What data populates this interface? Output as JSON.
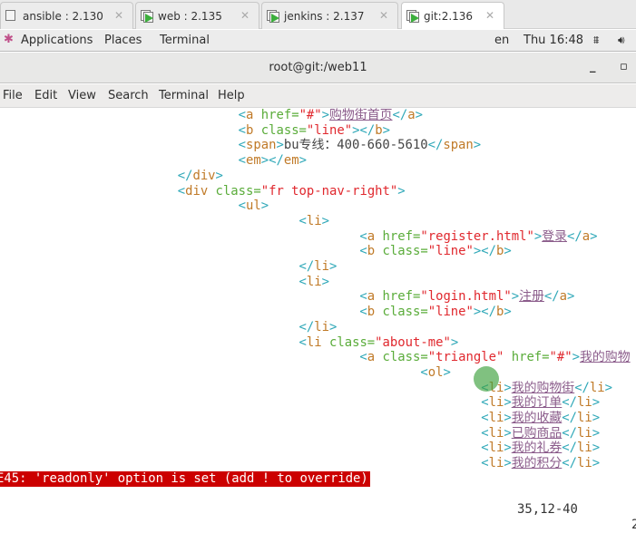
{
  "tabs": [
    {
      "label": "ansible : 2.130",
      "icon": "vm-icon",
      "active": false
    },
    {
      "label": "web : 2.135",
      "icon": "vm-running-icon",
      "active": false
    },
    {
      "label": "jenkins : 2.137",
      "icon": "vm-running-icon",
      "active": false
    },
    {
      "label": "git:2.136",
      "icon": "vm-running-icon",
      "active": true
    }
  ],
  "topbar": {
    "applications": "Applications",
    "places": "Places",
    "terminal": "Terminal",
    "lang": "en",
    "clock": "Thu 16:48"
  },
  "window": {
    "title": "root@git:/web11",
    "minimize": "_",
    "maximize": "▫"
  },
  "menu": [
    "File",
    "Edit",
    "View",
    "Search",
    "Terminal",
    "Help"
  ],
  "editor": {
    "lines": [
      {
        "indent": 32,
        "segs": [
          [
            "p",
            "<"
          ],
          [
            "t",
            "a"
          ],
          [
            "a",
            " href="
          ],
          [
            "s",
            "\"#\""
          ],
          [
            "p",
            ">"
          ],
          [
            "l",
            "购物街首页"
          ],
          [
            "p",
            "</"
          ],
          [
            "t",
            "a"
          ],
          [
            "p",
            ">"
          ]
        ]
      },
      {
        "indent": 32,
        "segs": [
          [
            "p",
            "<"
          ],
          [
            "t",
            "b"
          ],
          [
            "a",
            " class="
          ],
          [
            "s",
            "\"line\""
          ],
          [
            "p",
            ">"
          ],
          [
            "p",
            "</"
          ],
          [
            "t",
            "b"
          ],
          [
            "p",
            ">"
          ]
        ]
      },
      {
        "indent": 32,
        "segs": [
          [
            "p",
            "<"
          ],
          [
            "t",
            "span"
          ],
          [
            "p",
            ">"
          ],
          [
            "x",
            "bu专线：400-660-5610"
          ],
          [
            "p",
            "</"
          ],
          [
            "t",
            "span"
          ],
          [
            "p",
            ">"
          ]
        ]
      },
      {
        "indent": 32,
        "segs": [
          [
            "p",
            "<"
          ],
          [
            "t",
            "em"
          ],
          [
            "p",
            ">"
          ],
          [
            "p",
            "</"
          ],
          [
            "t",
            "em"
          ],
          [
            "p",
            ">"
          ]
        ]
      },
      {
        "indent": 24,
        "segs": [
          [
            "p",
            "</"
          ],
          [
            "t",
            "div"
          ],
          [
            "p",
            ">"
          ]
        ]
      },
      {
        "indent": 24,
        "segs": [
          [
            "p",
            "<"
          ],
          [
            "t",
            "div"
          ],
          [
            "a",
            " class="
          ],
          [
            "s",
            "\"fr top-nav-right\""
          ],
          [
            "p",
            ">"
          ]
        ]
      },
      {
        "indent": 32,
        "segs": [
          [
            "p",
            "<"
          ],
          [
            "t",
            "ul"
          ],
          [
            "p",
            ">"
          ]
        ]
      },
      {
        "indent": 40,
        "segs": [
          [
            "p",
            "<"
          ],
          [
            "t",
            "li"
          ],
          [
            "p",
            ">"
          ]
        ]
      },
      {
        "indent": 48,
        "segs": [
          [
            "p",
            "<"
          ],
          [
            "t",
            "a"
          ],
          [
            "a",
            " href="
          ],
          [
            "s",
            "\"register.html\""
          ],
          [
            "p",
            ">"
          ],
          [
            "l",
            "登录"
          ],
          [
            "p",
            "</"
          ],
          [
            "t",
            "a"
          ],
          [
            "p",
            ">"
          ]
        ]
      },
      {
        "indent": 48,
        "segs": [
          [
            "p",
            "<"
          ],
          [
            "t",
            "b"
          ],
          [
            "a",
            " class="
          ],
          [
            "s",
            "\"line\""
          ],
          [
            "p",
            ">"
          ],
          [
            "p",
            "</"
          ],
          [
            "t",
            "b"
          ],
          [
            "p",
            ">"
          ]
        ]
      },
      {
        "indent": 40,
        "segs": [
          [
            "p",
            "</"
          ],
          [
            "t",
            "li"
          ],
          [
            "p",
            ">"
          ]
        ]
      },
      {
        "indent": 40,
        "segs": [
          [
            "p",
            "<"
          ],
          [
            "t",
            "li"
          ],
          [
            "p",
            ">"
          ]
        ]
      },
      {
        "indent": 48,
        "segs": [
          [
            "p",
            "<"
          ],
          [
            "t",
            "a"
          ],
          [
            "a",
            " href="
          ],
          [
            "s",
            "\"login.html\""
          ],
          [
            "p",
            ">"
          ],
          [
            "l",
            "注册"
          ],
          [
            "p",
            "</"
          ],
          [
            "t",
            "a"
          ],
          [
            "p",
            ">"
          ]
        ]
      },
      {
        "indent": 48,
        "segs": [
          [
            "p",
            "<"
          ],
          [
            "t",
            "b"
          ],
          [
            "a",
            " class="
          ],
          [
            "s",
            "\"line\""
          ],
          [
            "p",
            ">"
          ],
          [
            "p",
            "</"
          ],
          [
            "t",
            "b"
          ],
          [
            "p",
            ">"
          ]
        ]
      },
      {
        "indent": 40,
        "segs": [
          [
            "p",
            "</"
          ],
          [
            "t",
            "li"
          ],
          [
            "p",
            ">"
          ]
        ]
      },
      {
        "indent": 40,
        "segs": [
          [
            "p",
            "<"
          ],
          [
            "t",
            "li"
          ],
          [
            "a",
            " class="
          ],
          [
            "s",
            "\"about-me\""
          ],
          [
            "p",
            ">"
          ]
        ]
      },
      {
        "indent": 48,
        "segs": [
          [
            "p",
            "<"
          ],
          [
            "t",
            "a"
          ],
          [
            "a",
            " class="
          ],
          [
            "s",
            "\"triangle\""
          ],
          [
            "a",
            " href="
          ],
          [
            "s",
            "\"#\""
          ],
          [
            "p",
            ">"
          ],
          [
            "l",
            "我的购物"
          ]
        ]
      },
      {
        "indent": 56,
        "segs": [
          [
            "p",
            "<"
          ],
          [
            "t",
            "ol"
          ],
          [
            "p",
            ">"
          ]
        ]
      },
      {
        "indent": 64,
        "segs": [
          [
            "p",
            "<"
          ],
          [
            "t",
            "li"
          ],
          [
            "p",
            ">"
          ],
          [
            "l",
            "我的购物街"
          ],
          [
            "p",
            "</"
          ],
          [
            "t",
            "li"
          ],
          [
            "p",
            ">"
          ]
        ]
      },
      {
        "indent": 64,
        "segs": [
          [
            "p",
            "<"
          ],
          [
            "t",
            "li"
          ],
          [
            "p",
            ">"
          ],
          [
            "l",
            "我的订单"
          ],
          [
            "p",
            "</"
          ],
          [
            "t",
            "li"
          ],
          [
            "p",
            ">"
          ]
        ]
      },
      {
        "indent": 64,
        "segs": [
          [
            "p",
            "<"
          ],
          [
            "t",
            "li"
          ],
          [
            "p",
            ">"
          ],
          [
            "l",
            "我的收藏"
          ],
          [
            "p",
            "</"
          ],
          [
            "t",
            "li"
          ],
          [
            "p",
            ">"
          ]
        ]
      },
      {
        "indent": 64,
        "segs": [
          [
            "p",
            "<"
          ],
          [
            "t",
            "li"
          ],
          [
            "p",
            ">"
          ],
          [
            "l",
            "已购商品"
          ],
          [
            "p",
            "</"
          ],
          [
            "t",
            "li"
          ],
          [
            "p",
            ">"
          ]
        ]
      },
      {
        "indent": 64,
        "segs": [
          [
            "p",
            "<"
          ],
          [
            "t",
            "li"
          ],
          [
            "p",
            ">"
          ],
          [
            "l",
            "我的礼券"
          ],
          [
            "p",
            "</"
          ],
          [
            "t",
            "li"
          ],
          [
            "p",
            ">"
          ]
        ]
      },
      {
        "indent": 64,
        "segs": [
          [
            "p",
            "<"
          ],
          [
            "t",
            "li"
          ],
          [
            "p",
            ">"
          ],
          [
            "l",
            "我的积分"
          ],
          [
            "p",
            "</"
          ],
          [
            "t",
            "li"
          ],
          [
            "p",
            ">"
          ]
        ]
      }
    ]
  },
  "status": {
    "error": "E45: 'readonly' option is set (add ! to override)",
    "position": "35,12-40",
    "percent": "2"
  },
  "colors": {
    "bracket": "#2fa8b8",
    "tag": "#c07a28",
    "attr": "#5aac3a",
    "string": "#e0282e",
    "link": "#8b5c8b",
    "error_bg": "#cc0000"
  }
}
